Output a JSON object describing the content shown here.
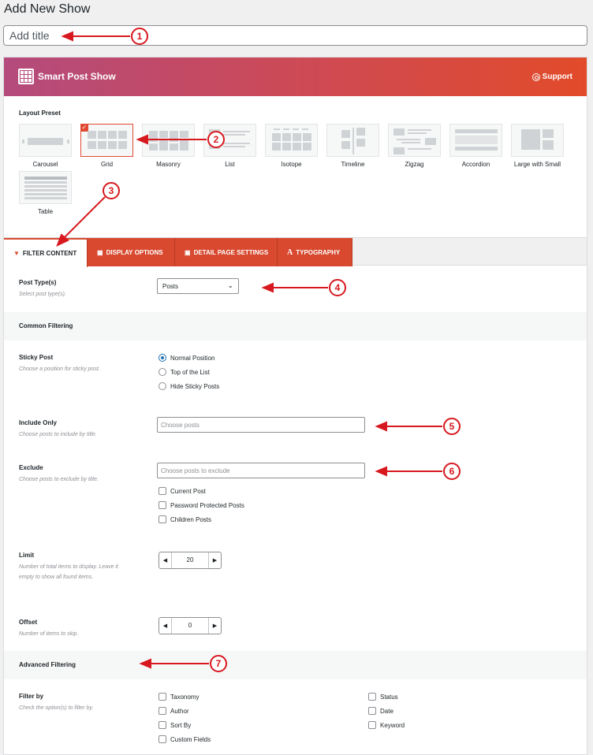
{
  "page": {
    "title": "Add New Show",
    "title_placeholder": "Add title"
  },
  "header": {
    "brand": "Smart Post Show",
    "support": "Support"
  },
  "layout": {
    "label": "Layout Preset",
    "presets": [
      "Carousel",
      "Grid",
      "Masonry",
      "List",
      "Isotope",
      "Timeline",
      "Zigzag",
      "Accordion",
      "Large with Small",
      "Table"
    ],
    "selected": "Grid"
  },
  "tabs": [
    "FILTER CONTENT",
    "DISPLAY OPTIONS",
    "DETAIL PAGE SETTINGS",
    "TYPOGRAPHY"
  ],
  "post_type": {
    "label": "Post Type(s)",
    "desc": "Select post type(s).",
    "value": "Posts"
  },
  "common": {
    "title": "Common Filtering"
  },
  "sticky": {
    "label": "Sticky Post",
    "desc": "Choose a position for sticky post.",
    "options": [
      "Normal Position",
      "Top of the List",
      "Hide Sticky Posts"
    ]
  },
  "include": {
    "label": "Include Only",
    "desc": "Choose posts to include by title.",
    "placeholder": "Choose posts"
  },
  "exclude": {
    "label": "Exclude",
    "desc": "Choose posts to exclude by title.",
    "placeholder": "Choose posts to exclude",
    "options": [
      "Current Post",
      "Password Protected Posts",
      "Children Posts"
    ]
  },
  "limit": {
    "label": "Limit",
    "desc": "Number of total items to display. Leave it empty to show all found items.",
    "value": "20"
  },
  "offset": {
    "label": "Offset",
    "desc": "Number of items to skip.",
    "value": "0"
  },
  "advanced": {
    "title": "Advanced Filtering"
  },
  "filter_by": {
    "label": "Filter by",
    "desc": "Check the option(s) to filter by.",
    "col1": [
      "Taxonomy",
      "Author",
      "Sort By",
      "Custom Fields"
    ],
    "col2": [
      "Status",
      "Date",
      "Keyword"
    ]
  },
  "callouts": [
    "1",
    "2",
    "3",
    "4",
    "5",
    "6",
    "7"
  ],
  "colors": {
    "accent": "#d8492f",
    "annotation": "#d7181f",
    "radio_on": "#2271b1"
  }
}
